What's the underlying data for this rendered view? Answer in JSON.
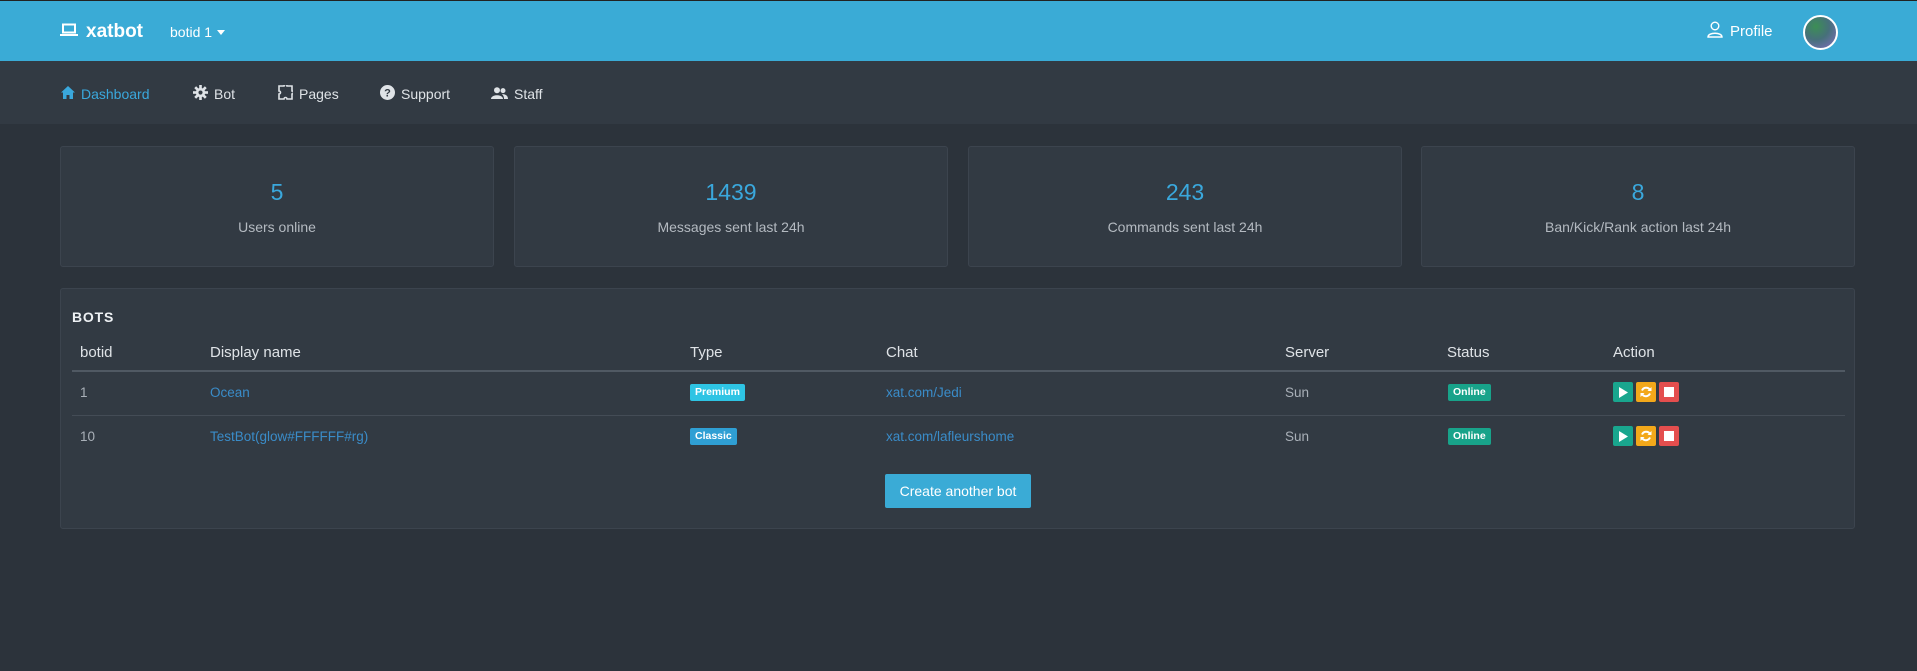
{
  "header": {
    "brand": "xatbot",
    "botid_selector": "botid 1",
    "profile_label": "Profile"
  },
  "nav": {
    "items": [
      {
        "label": "Dashboard",
        "icon": "home-icon"
      },
      {
        "label": "Bot",
        "icon": "gear-icon"
      },
      {
        "label": "Pages",
        "icon": "puzzle-icon"
      },
      {
        "label": "Support",
        "icon": "question-icon"
      },
      {
        "label": "Staff",
        "icon": "users-icon"
      }
    ]
  },
  "stats": [
    {
      "value": "5",
      "label": "Users online"
    },
    {
      "value": "1439",
      "label": "Messages sent last 24h"
    },
    {
      "value": "243",
      "label": "Commands sent last 24h"
    },
    {
      "value": "8",
      "label": "Ban/Kick/Rank action last 24h"
    }
  ],
  "bots": {
    "title": "BOTS",
    "columns": [
      "botid",
      "Display name",
      "Type",
      "Chat",
      "Server",
      "Status",
      "Action"
    ],
    "rows": [
      {
        "botid": "1",
        "display_name": "Ocean",
        "type": "Premium",
        "chat": "xat.com/Jedi",
        "server": "Sun",
        "status": "Online"
      },
      {
        "botid": "10",
        "display_name": "TestBot(glow#FFFFFF#rg)",
        "type": "Classic",
        "chat": "xat.com/lafleurshome",
        "server": "Sun",
        "status": "Online"
      }
    ],
    "create_button": "Create another bot"
  },
  "colors": {
    "topbar": "#3aabd6",
    "accent": "#3aa8dd",
    "background": "#2c333b",
    "online_badge": "#18a38a",
    "premium_badge": "#2ec4e4",
    "classic_badge": "#2f9fd4",
    "start_button": "#19a68e",
    "restart_button": "#f3a81a",
    "stop_button": "#e44e4e"
  }
}
